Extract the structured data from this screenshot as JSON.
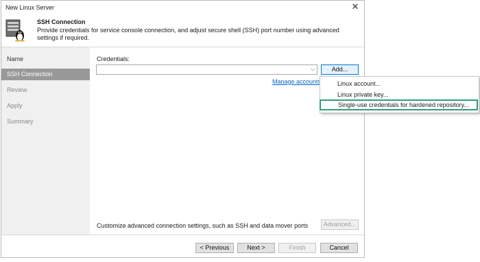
{
  "window": {
    "title": "New Linux Server",
    "close_icon": "close-icon"
  },
  "header": {
    "title": "SSH Connection",
    "description": "Provide credentials for service console connection, and adjust secure shell (SSH) port number using advanced settings if required.",
    "logo_icon": "linux-server-icon"
  },
  "sidebar": {
    "items": [
      {
        "label": "Name",
        "state": "done"
      },
      {
        "label": "SSH Connection",
        "state": "active"
      },
      {
        "label": "Review",
        "state": "pending"
      },
      {
        "label": "Apply",
        "state": "pending"
      },
      {
        "label": "Summary",
        "state": "pending"
      }
    ]
  },
  "credentials": {
    "label": "Credentials:",
    "value": "",
    "add_label": "Add...",
    "manage_link": "Manage accounts"
  },
  "add_menu": {
    "items": [
      {
        "label": "Linux account..."
      },
      {
        "label": "Linux private key..."
      },
      {
        "label": "Single-use credentials for hardened repository..."
      }
    ],
    "highlight_color": "#2e9e77"
  },
  "advanced": {
    "text": "Customize advanced connection settings, such as SSH and data mover ports",
    "button_label": "Advanced..."
  },
  "footer": {
    "previous_label": "< Previous",
    "next_label": "Next >",
    "finish_label": "Finish",
    "cancel_label": "Cancel"
  },
  "colors": {
    "active_step": "#999999",
    "link": "#0066cc",
    "sidebar_bg": "#f0f0f0"
  }
}
